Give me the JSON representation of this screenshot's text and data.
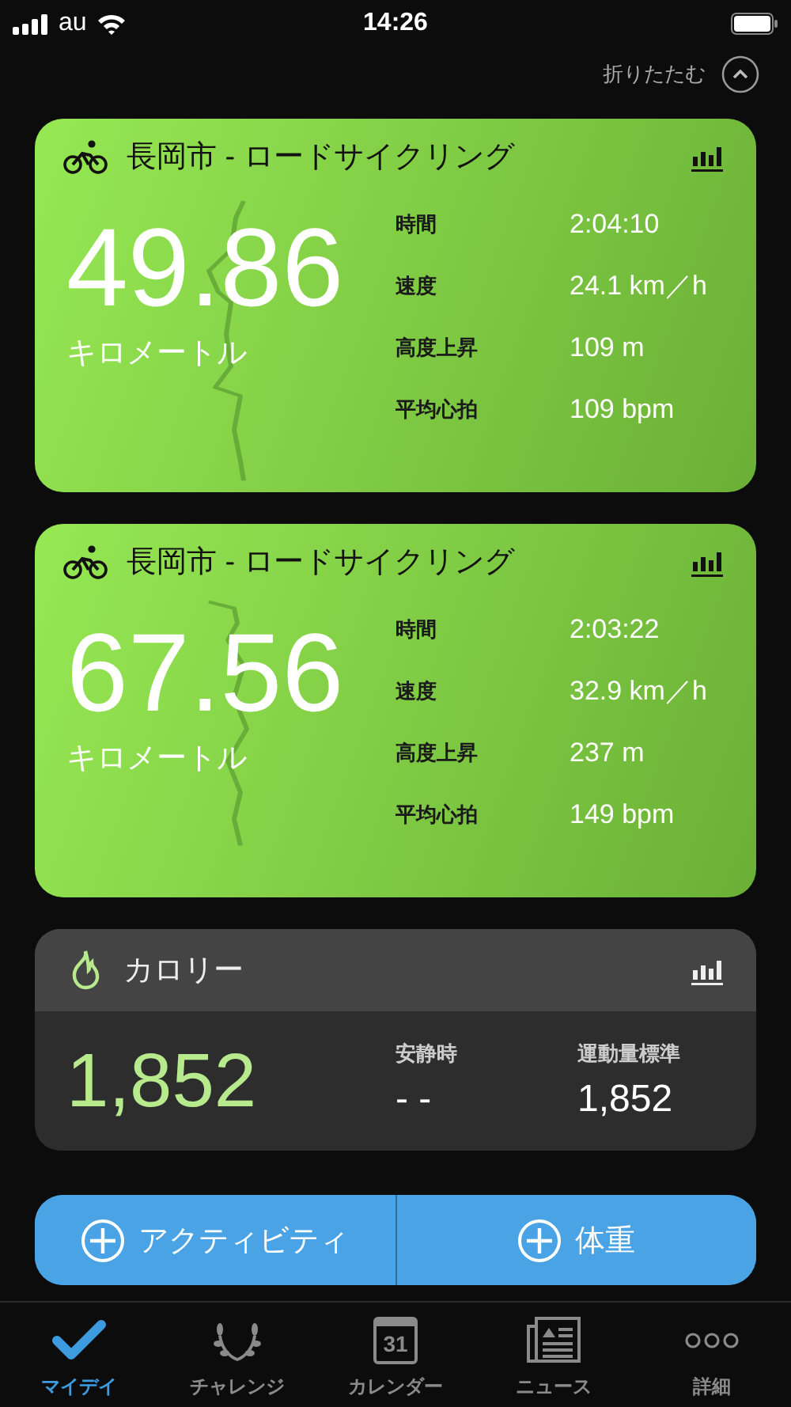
{
  "status_bar": {
    "carrier": "au",
    "time": "14:26"
  },
  "collapse": {
    "label": "折りたたむ"
  },
  "cards": [
    {
      "kind": "activity",
      "title": "長岡市 - ロードサイクリング",
      "distance": "49.86",
      "unit": "キロメートル",
      "stats": [
        {
          "label": "時間",
          "value": "2:04:10"
        },
        {
          "label": "速度",
          "value": "24.1 km／h"
        },
        {
          "label": "高度上昇",
          "value": "109 m"
        },
        {
          "label": "平均心拍",
          "value": "109 bpm"
        }
      ]
    },
    {
      "kind": "activity",
      "title": "長岡市 - ロードサイクリング",
      "distance": "67.56",
      "unit": "キロメートル",
      "stats": [
        {
          "label": "時間",
          "value": "2:03:22"
        },
        {
          "label": "速度",
          "value": "32.9 km／h"
        },
        {
          "label": "高度上昇",
          "value": "237 m"
        },
        {
          "label": "平均心拍",
          "value": "149 bpm"
        }
      ]
    },
    {
      "kind": "calories",
      "title": "カロリー",
      "total": "1,852",
      "stats": [
        {
          "label": "安静時",
          "value": "- -"
        },
        {
          "label": "運動量標準",
          "value": "1,852"
        }
      ]
    }
  ],
  "actions": [
    {
      "label": "アクティビティ"
    },
    {
      "label": "体重"
    }
  ],
  "tabs": [
    {
      "kind": "check",
      "label": "マイデイ",
      "selected": true
    },
    {
      "kind": "laurel",
      "label": "チャレンジ",
      "selected": false
    },
    {
      "kind": "calendar",
      "label": "カレンダー",
      "icon_text": "31",
      "selected": false
    },
    {
      "kind": "news",
      "label": "ニュース",
      "selected": false
    },
    {
      "kind": "more",
      "label": "詳細",
      "selected": false
    }
  ]
}
